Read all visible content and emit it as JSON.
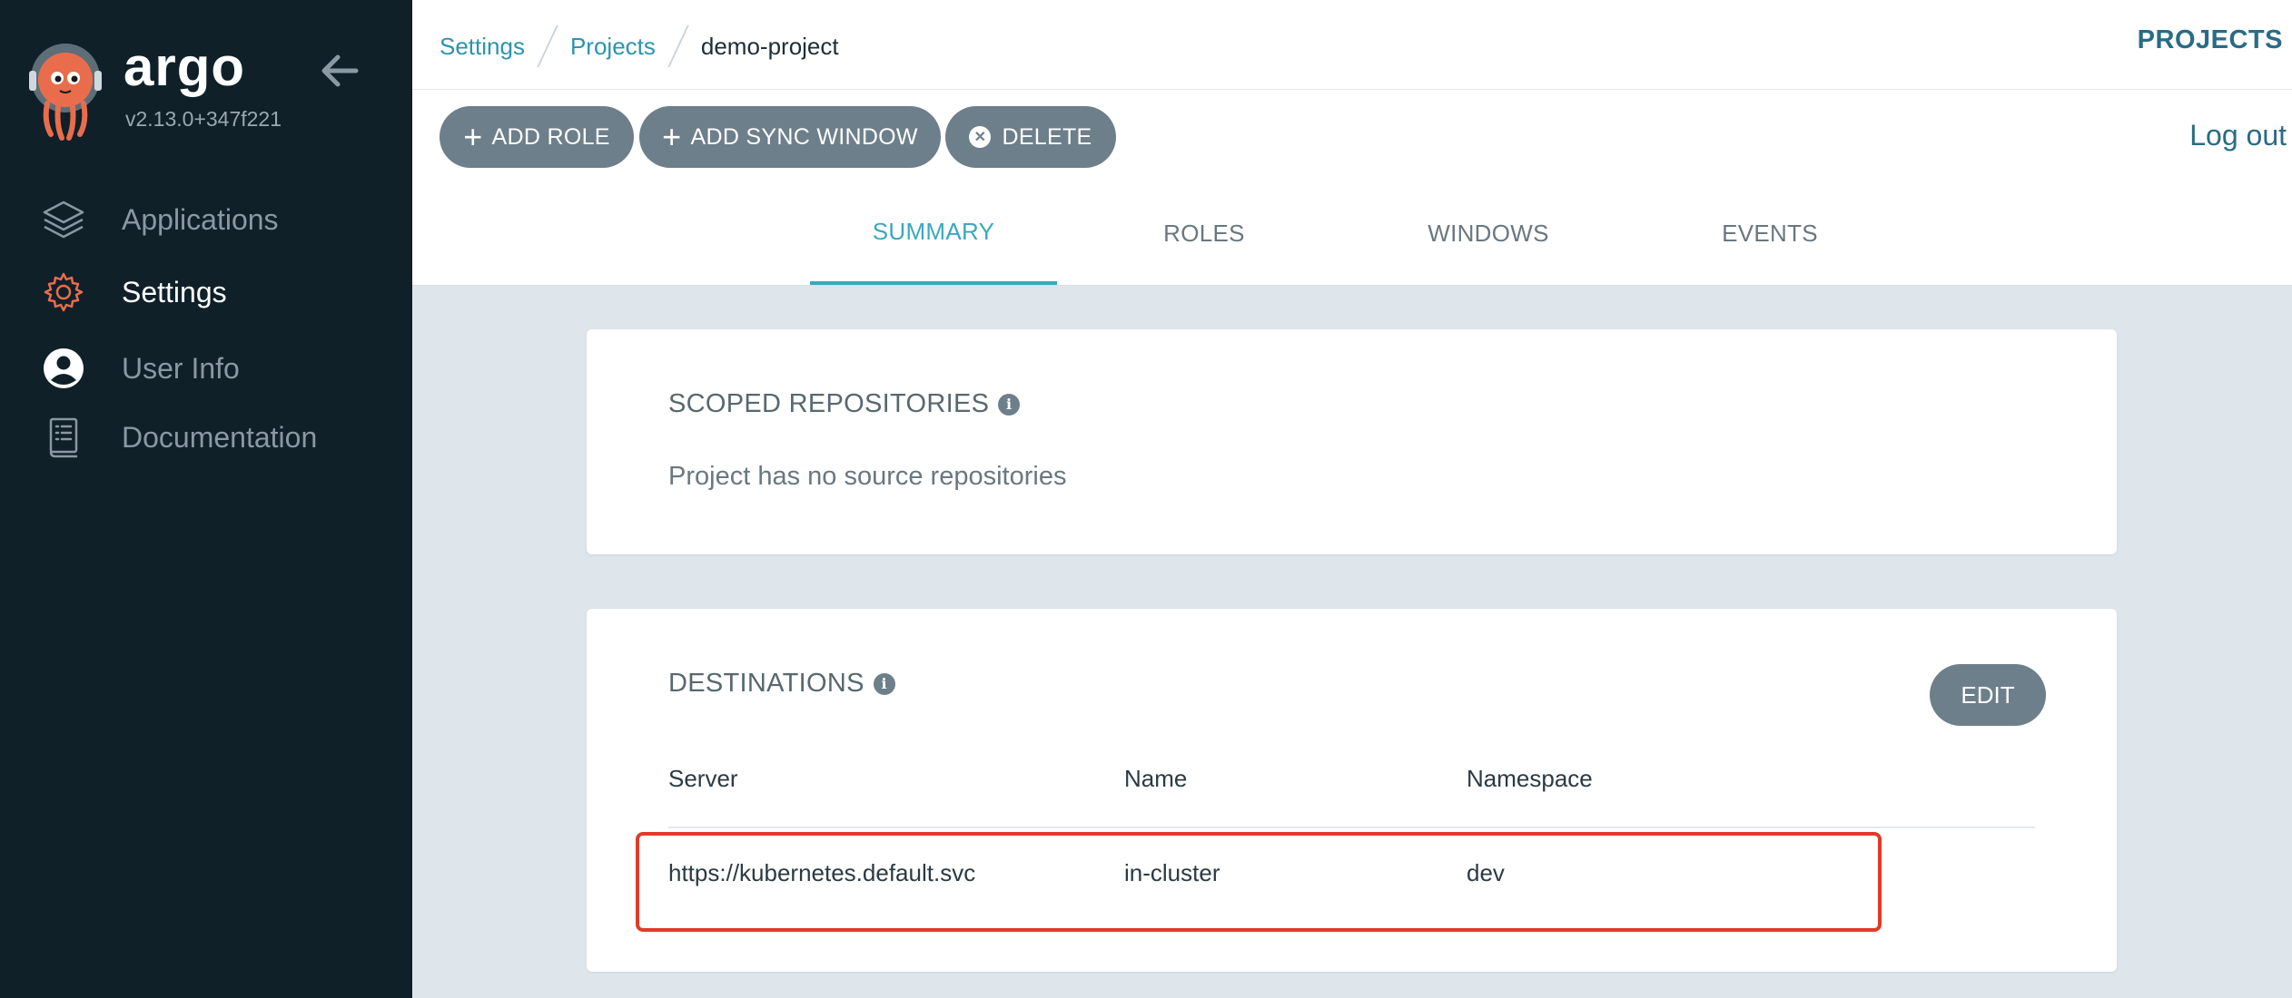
{
  "sidebar": {
    "brand": "argo",
    "version": "v2.13.0+347f221",
    "items": [
      {
        "label": "Applications",
        "icon": "layers-icon",
        "active": false
      },
      {
        "label": "Settings",
        "icon": "gear-icon",
        "active": true
      },
      {
        "label": "User Info",
        "icon": "user-icon",
        "active": false
      },
      {
        "label": "Documentation",
        "icon": "book-icon",
        "active": false
      }
    ]
  },
  "header": {
    "breadcrumbs": [
      "Settings",
      "Projects",
      "demo-project"
    ],
    "title": "PROJECTS"
  },
  "toolbar": {
    "add_role": "ADD ROLE",
    "add_sync_window": "ADD SYNC WINDOW",
    "delete": "DELETE",
    "logout": "Log out"
  },
  "tabs": [
    {
      "label": "SUMMARY",
      "active": true
    },
    {
      "label": "ROLES",
      "active": false
    },
    {
      "label": "WINDOWS",
      "active": false
    },
    {
      "label": "EVENTS",
      "active": false
    }
  ],
  "scoped_repositories": {
    "title": "SCOPED REPOSITORIES",
    "empty_text": "Project has no source repositories"
  },
  "destinations": {
    "title": "DESTINATIONS",
    "edit_label": "EDIT",
    "columns": [
      "Server",
      "Name",
      "Namespace"
    ],
    "rows": [
      {
        "server": "https://kubernetes.default.svc",
        "name": "in-cluster",
        "namespace": "dev"
      }
    ]
  },
  "colors": {
    "sidebar_bg": "#0f2029",
    "accent": "#3aa8bf",
    "button_bg": "#6d7f8b",
    "highlight": "#e23a2a",
    "logo_orange": "#e96d4c"
  }
}
